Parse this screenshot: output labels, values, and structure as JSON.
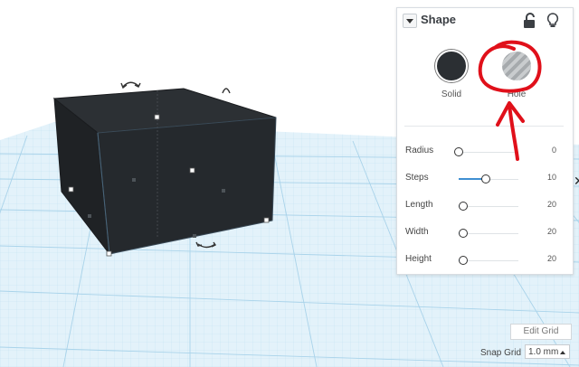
{
  "panel": {
    "title": "Shape",
    "modes": {
      "solid": "Solid",
      "hole": "Hole"
    },
    "params": [
      {
        "label": "Radius",
        "value": "0",
        "fraction": 0.0
      },
      {
        "label": "Steps",
        "value": "10",
        "fraction": 0.45
      },
      {
        "label": "Length",
        "value": "20",
        "fraction": 0.08
      },
      {
        "label": "Width",
        "value": "20",
        "fraction": 0.08
      },
      {
        "label": "Height",
        "value": "20",
        "fraction": 0.08
      }
    ]
  },
  "grid": {
    "edit_label": "Edit Grid",
    "snap_label": "Snap Grid",
    "snap_value": "1.0 mm"
  },
  "icons": {
    "panel_toggle": "chevron-down-icon",
    "lock": "unlock-icon",
    "bulb": "lightbulb-icon",
    "rotate": "rotate-arrow-icon"
  },
  "colors": {
    "grid_line": "#b9dcef",
    "grid_fill": "#dff0f9",
    "shape_fill": "#222528",
    "accent": "#3f8fd2",
    "annotation": "#e0101a"
  }
}
